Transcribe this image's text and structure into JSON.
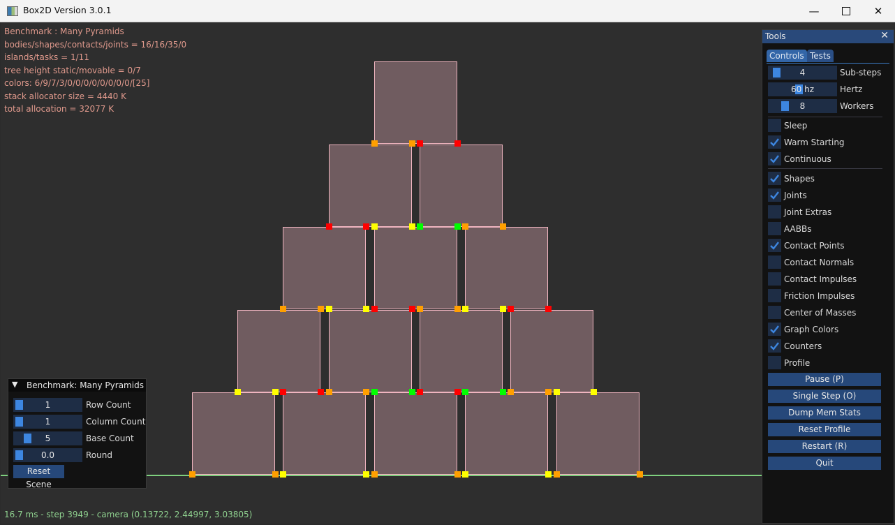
{
  "window": {
    "title": "Box2D Version 3.0.1",
    "icon": "app-window-icon",
    "controls": {
      "minimize": "—",
      "maximize": "☐",
      "close": "✕"
    }
  },
  "stats": {
    "lines": [
      "Benchmark : Many Pyramids",
      "bodies/shapes/contacts/joints = 16/16/35/0",
      "islands/tasks = 1/11",
      "tree height static/movable = 0/7",
      "colors: 6/9/7/3/0/0/0/0/0/0/0/0/[25]",
      "stack allocator size = 4440 K",
      "total allocation = 32077 K"
    ]
  },
  "footer": "16.7 ms - step 3949 - camera (0.13722, 2.44997, 3.03805)",
  "colors": {
    "box_fill": "#705c60",
    "box_outline": "#f0b5c0",
    "ground": "#7ed07e",
    "contact_red": "#ff0000",
    "contact_orange": "#ff9f00",
    "contact_yellow": "#ffff00",
    "contact_green": "#00ff00",
    "stats_text": "#e19a8d",
    "footer_text": "#8fd18f",
    "accent": "#3d86e0"
  },
  "scene": {
    "pyramid_base_count": 5,
    "rows": [
      {
        "row": 0,
        "boxes": 5
      },
      {
        "row": 1,
        "boxes": 4
      },
      {
        "row": 2,
        "boxes": 3
      },
      {
        "row": 3,
        "boxes": 2
      },
      {
        "row": 4,
        "boxes": 1
      }
    ],
    "contact_levels": [
      {
        "level": "ground",
        "colors": [
          "orange",
          "orange",
          "yellow",
          "yellow",
          "orange",
          "orange",
          "yellow",
          "yellow",
          "orange",
          "orange"
        ]
      },
      {
        "level": "row0-row1",
        "colors": [
          "yellow",
          "yellow",
          "red",
          "red",
          "orange",
          "orange",
          "green",
          "green",
          "red",
          "red",
          "green",
          "green",
          "orange",
          "orange",
          "yellow",
          "yellow"
        ]
      },
      {
        "level": "row1-row2",
        "colors": [
          "orange",
          "orange",
          "yellow",
          "yellow",
          "red",
          "red",
          "orange",
          "orange",
          "yellow",
          "yellow",
          "red",
          "red"
        ]
      },
      {
        "level": "row2-row3",
        "colors": [
          "red",
          "red",
          "yellow",
          "yellow",
          "green",
          "green",
          "orange",
          "orange"
        ]
      },
      {
        "level": "row3-row4",
        "colors": [
          "orange",
          "orange",
          "red",
          "red"
        ]
      }
    ]
  },
  "tools": {
    "title": "Tools",
    "close_icon": "✕",
    "tabs": [
      {
        "label": "Controls",
        "active": true
      },
      {
        "label": "Tests",
        "active": false
      }
    ],
    "sliders": [
      {
        "label": "Sub-steps",
        "value": "4",
        "fraction": 0.05
      },
      {
        "label": "Hertz",
        "value": "60 hz",
        "fraction": 0.45
      },
      {
        "label": "Workers",
        "value": "8",
        "fraction": 0.2
      }
    ],
    "checkboxes_group1": [
      {
        "label": "Sleep",
        "checked": false
      },
      {
        "label": "Warm Starting",
        "checked": true
      },
      {
        "label": "Continuous",
        "checked": true
      }
    ],
    "checkboxes_group2": [
      {
        "label": "Shapes",
        "checked": true
      },
      {
        "label": "Joints",
        "checked": true
      },
      {
        "label": "Joint Extras",
        "checked": false
      },
      {
        "label": "AABBs",
        "checked": false
      },
      {
        "label": "Contact Points",
        "checked": true
      },
      {
        "label": "Contact Normals",
        "checked": false
      },
      {
        "label": "Contact Impulses",
        "checked": false
      },
      {
        "label": "Friction Impulses",
        "checked": false
      },
      {
        "label": "Center of Masses",
        "checked": false
      },
      {
        "label": "Graph Colors",
        "checked": true
      },
      {
        "label": "Counters",
        "checked": true
      },
      {
        "label": "Profile",
        "checked": false
      }
    ],
    "buttons": [
      "Pause (P)",
      "Single Step (O)",
      "Dump Mem Stats",
      "Reset Profile",
      "Restart (R)",
      "Quit"
    ]
  },
  "benchmark": {
    "title": "Benchmark: Many Pyramids",
    "collapse_icon": "▼",
    "sliders": [
      {
        "label": "Row Count",
        "value": "1",
        "fraction": 0.0
      },
      {
        "label": "Column Count",
        "value": "1",
        "fraction": 0.0
      },
      {
        "label": "Base Count",
        "value": "5",
        "fraction": 0.15
      },
      {
        "label": "Round",
        "value": "0.0",
        "fraction": 0.0
      }
    ],
    "reset_label": "Reset Scene"
  }
}
